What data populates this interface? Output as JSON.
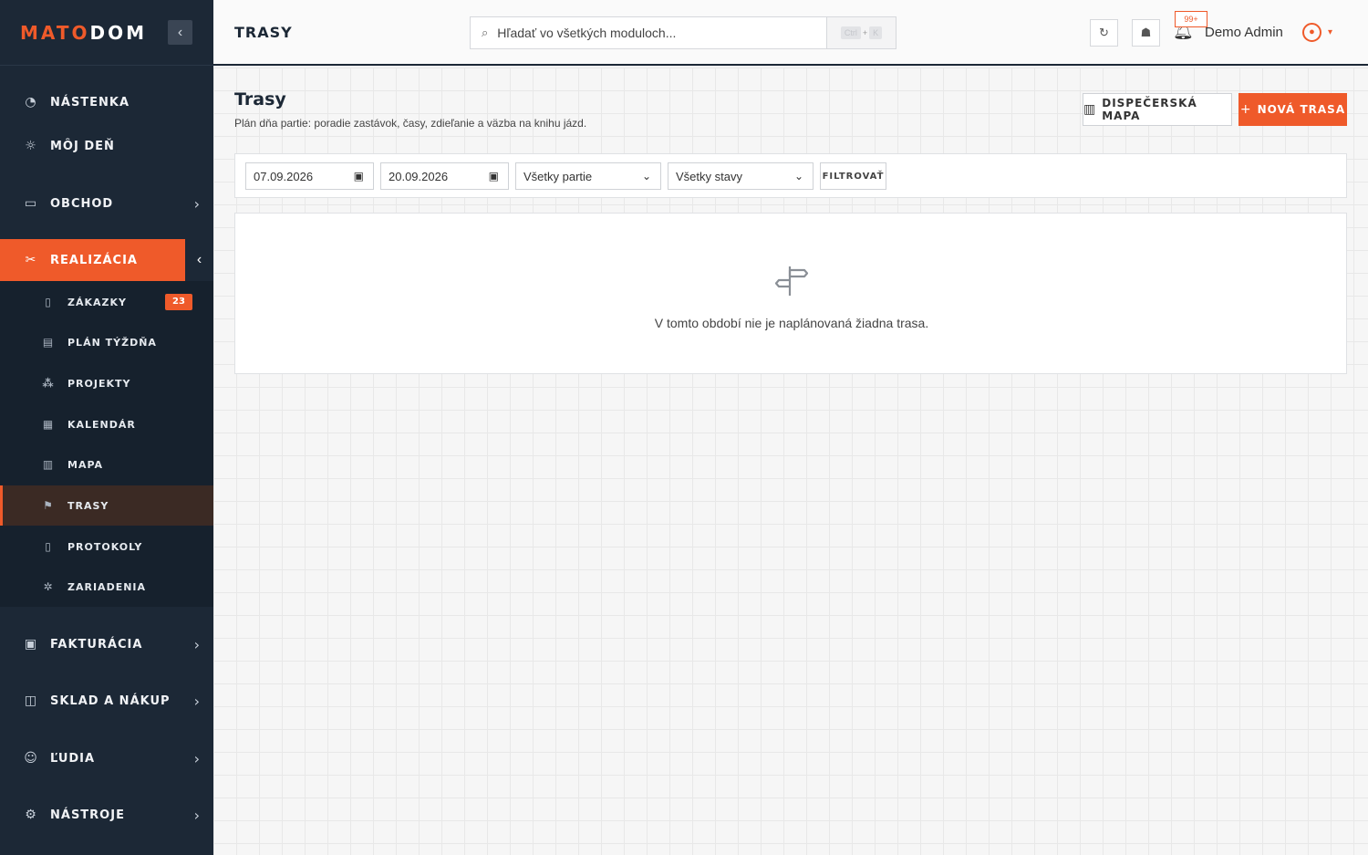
{
  "brand": {
    "logo_part1": "MATO",
    "logo_part2": "DOM",
    "accent_color": "#ef5a2a",
    "sidebar_color": "#1c2836"
  },
  "sidebar": {
    "items": [
      {
        "label": "NÁSTENKA",
        "icon": "dashboard-icon"
      },
      {
        "label": "MÔJ DEŇ",
        "icon": "sun-icon"
      },
      {
        "label": "OBCHOD",
        "icon": "briefcase-icon"
      },
      {
        "label": "REALIZÁCIA",
        "icon": "tools-icon",
        "active": true
      },
      {
        "label": "FAKTURÁCIA",
        "icon": "invoice-icon"
      },
      {
        "label": "SKLAD A NÁKUP",
        "icon": "box-icon"
      },
      {
        "label": "ĽUDIA",
        "icon": "people-icon"
      },
      {
        "label": "NÁSTROJE",
        "icon": "gear-icon"
      }
    ],
    "subitems": [
      {
        "label": "ZÁKAZKY",
        "icon": "document-icon",
        "badge": "23"
      },
      {
        "label": "PLÁN TÝŽDŇA",
        "icon": "calendar-week-icon"
      },
      {
        "label": "PROJEKTY",
        "icon": "hierarchy-icon"
      },
      {
        "label": "KALENDÁR",
        "icon": "calendar-icon"
      },
      {
        "label": "MAPA",
        "icon": "map-icon"
      },
      {
        "label": "TRASY",
        "icon": "signpost-icon",
        "active": true
      },
      {
        "label": "PROTOKOLY",
        "icon": "clipboard-icon"
      },
      {
        "label": "ZARIADENIA",
        "icon": "cog-icon"
      }
    ]
  },
  "header": {
    "title": "TRASY",
    "search_placeholder": "Hľadať vo všetkých moduloch...",
    "shortcut_ctrl": "Ctrl",
    "shortcut_plus": "+",
    "shortcut_key": "K",
    "notifications_badge": "99+",
    "user_name": "Demo Admin"
  },
  "page": {
    "title": "Trasy",
    "subtitle": "Plán dňa partie: poradie zastávok, časy, zdieľanie a väzba na knihu jázd.",
    "btn_dispatch": "DISPEČERSKÁ MAPA",
    "btn_new": "NOVÁ TRASA"
  },
  "filters": {
    "date_from": "07.09.2026",
    "date_to": "20.09.2026",
    "crew_select": "Všetky partie",
    "status_select": "Všetky stavy",
    "btn_filter": "FILTROVAŤ"
  },
  "empty_state": {
    "message": "V tomto období nie je naplánovaná žiadna trasa."
  }
}
